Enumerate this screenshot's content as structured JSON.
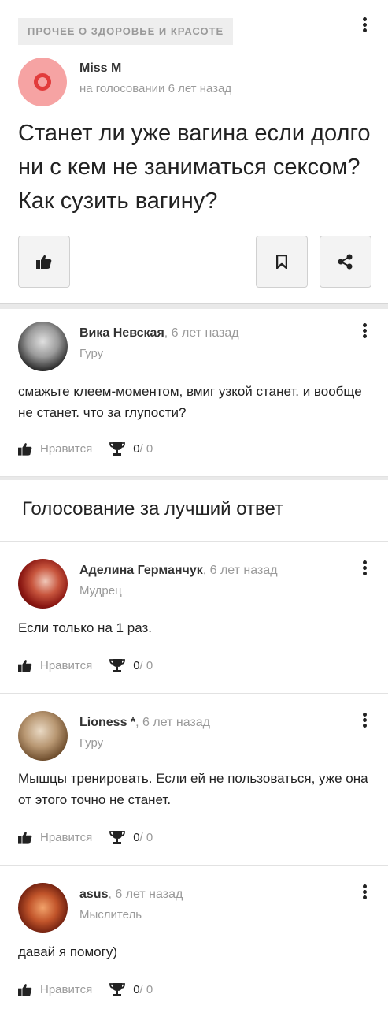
{
  "question": {
    "category": "ПРОЧЕЕ О ЗДОРОВЬЕ И КРАСОТЕ",
    "author": "Miss M",
    "meta": "на голосовании 6 лет назад",
    "title": "Станет ли уже вагина если долго ни с кем не заниматься сексом? Как сузить вагину?"
  },
  "colors": {
    "accent_avatar_bg": "#f6a3a3",
    "accent_avatar_ring": "#e23b3b"
  },
  "like_label": "Нравится",
  "answers_top": [
    {
      "author": "Вика Невская",
      "ago": ", 6 лет назад",
      "rank": "Гуру",
      "text": "смажьте клеем-моментом, вмиг узкой станет. и вообще не станет. что за глупости?",
      "score_num": "0",
      "score_rest": " / 0"
    }
  ],
  "voting_section": {
    "title": "Голосование за лучший ответ"
  },
  "answers_vote": [
    {
      "author": "Аделина Германчук",
      "ago": ", 6 лет назад",
      "rank": "Мудрец",
      "text": "Если только на 1 раз.",
      "score_num": "0",
      "score_rest": " / 0"
    },
    {
      "author": "Lioness *",
      "ago": ", 6 лет назад",
      "rank": "Гуру",
      "text": "Мышцы тренировать. Если ей не пользоваться, уже она от этого точно не станет.",
      "score_num": "0",
      "score_rest": " / 0"
    },
    {
      "author": "asus",
      "ago": ", 6 лет назад",
      "rank": "Мыслитель",
      "text": "давай я помогу)",
      "score_num": "0",
      "score_rest": " / 0"
    }
  ]
}
